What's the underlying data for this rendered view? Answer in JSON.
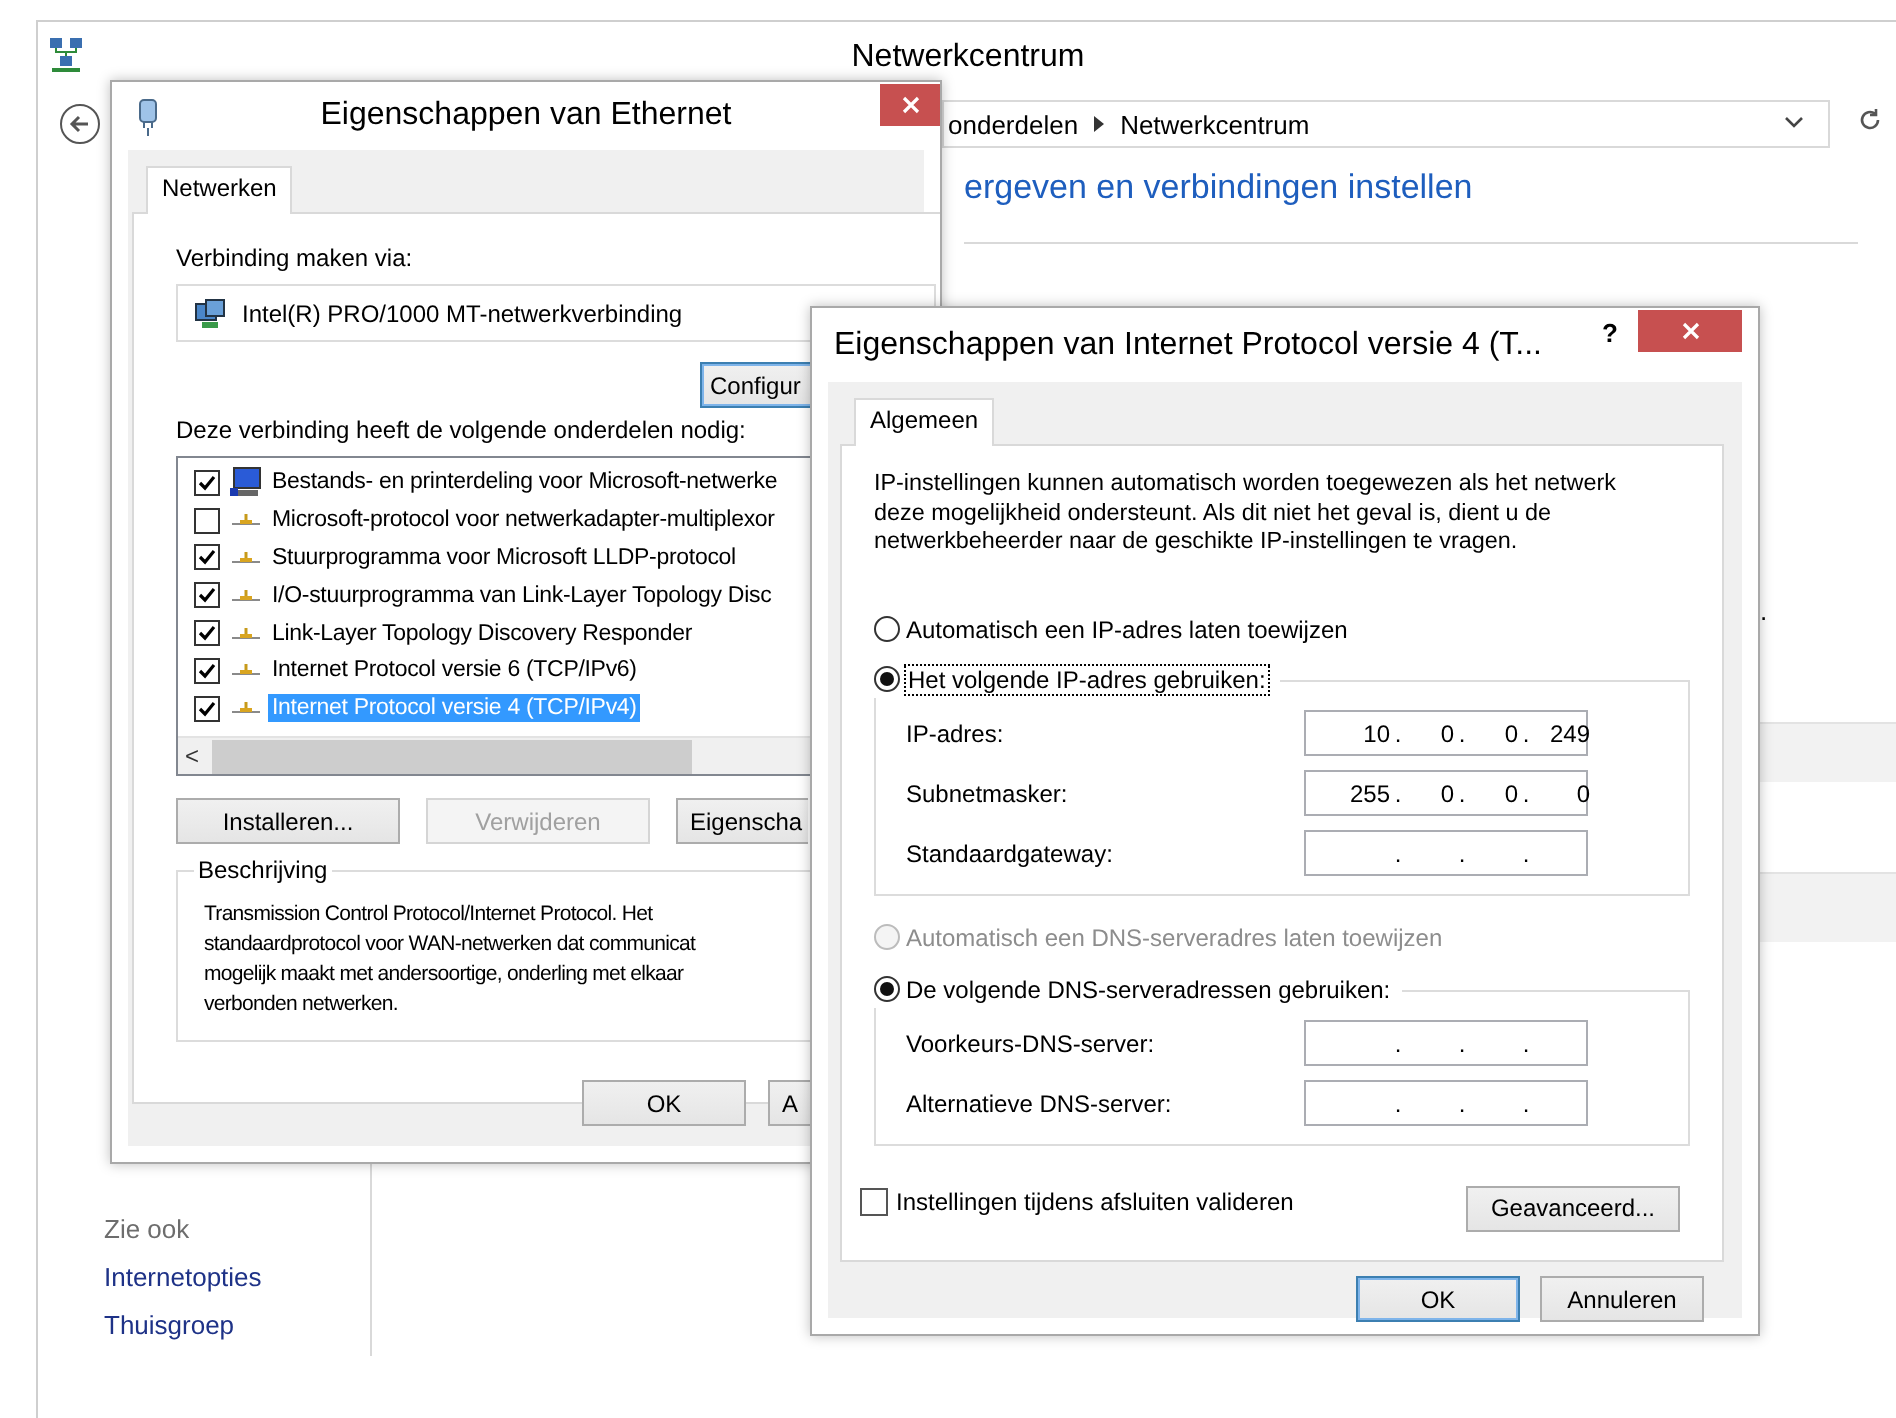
{
  "background_window": {
    "title": "Netwerkcentrum",
    "breadcrumb": [
      {
        "label": "onderdelen"
      },
      {
        "label": "Netwerkcentrum"
      }
    ],
    "heading": "ergeven en verbindingen instellen",
    "fragment": ".",
    "see_also": {
      "title": "Zie ook",
      "links": [
        "Internetopties",
        "Thuisgroep"
      ]
    }
  },
  "ethernet_dialog": {
    "title": "Eigenschappen van Ethernet",
    "tabs": [
      {
        "label": "Netwerken",
        "selected": true
      }
    ],
    "connect_via_label": "Verbinding maken via:",
    "adapter": "Intel(R) PRO/1000 MT-netwerkverbinding",
    "configure_button": {
      "label": "Configur",
      "default": true
    },
    "components_label": "Deze verbinding heeft de volgende onderdelen nodig:",
    "components": [
      {
        "kind": "computer",
        "label": "Bestands- en printerdeling voor Microsoft-netwerke",
        "checked": true,
        "selected": false
      },
      {
        "kind": "protocol",
        "label": "Microsoft-protocol voor netwerkadapter-multiplexor",
        "checked": false,
        "selected": false
      },
      {
        "kind": "protocol",
        "label": "Stuurprogramma voor Microsoft LLDP-protocol",
        "checked": true,
        "selected": false
      },
      {
        "kind": "protocol",
        "label": "I/O-stuurprogramma van Link-Layer Topology Disc",
        "checked": true,
        "selected": false
      },
      {
        "kind": "protocol",
        "label": "Link-Layer Topology Discovery Responder",
        "checked": true,
        "selected": false
      },
      {
        "kind": "protocol",
        "label": "Internet Protocol versie 6 (TCP/IPv6)",
        "checked": true,
        "selected": false
      },
      {
        "kind": "protocol",
        "label": "Internet Protocol versie 4 (TCP/IPv4)",
        "checked": true,
        "selected": true
      }
    ],
    "scroll_left": "<",
    "buttons": [
      {
        "label": "Installeren...",
        "disabled": false
      },
      {
        "label": "Verwijderen",
        "disabled": true
      },
      {
        "label": "Eigenscha",
        "disabled": false
      }
    ],
    "description": {
      "title": "Beschrijving",
      "lines": [
        "Transmission Control Protocol/Internet Protocol. Het",
        "standaardprotocol voor WAN-netwerken dat communicat",
        "mogelijk maakt met andersoortige, onderling met elkaar",
        "verbonden netwerken."
      ]
    },
    "footer_buttons": [
      {
        "label": "OK"
      },
      {
        "label": "A"
      }
    ]
  },
  "ipv4_dialog": {
    "title": "Eigenschappen van Internet Protocol versie 4 (T...",
    "help": "?",
    "tabs": [
      {
        "label": "Algemeen",
        "selected": true
      }
    ],
    "intro": "IP-instellingen kunnen automatisch worden toegewezen als het netwerk deze mogelijkheid ondersteunt. Als dit niet het geval is, dient u de netwerkbeheerder naar de geschikte IP-instellingen te vragen.",
    "ip_options": [
      {
        "label": "Automatisch een IP-adres laten toewijzen",
        "selected": false,
        "disabled": false,
        "focused": false
      },
      {
        "label": "Het volgende IP-adres gebruiken:",
        "selected": true,
        "disabled": false,
        "focused": true
      }
    ],
    "ip_fields": [
      {
        "label": "IP-adres:",
        "octets": [
          "10",
          "0",
          "0",
          "249"
        ],
        "dots": [
          ".",
          ".",
          "."
        ]
      },
      {
        "label": "Subnetmasker:",
        "octets": [
          "255",
          "0",
          "0",
          "0"
        ],
        "dots": [
          ".",
          ".",
          "."
        ]
      },
      {
        "label": "Standaardgateway:",
        "dots": [
          ".",
          ".",
          "."
        ]
      }
    ],
    "dns_options": [
      {
        "label": "Automatisch een DNS-serveradres laten toewijzen",
        "selected": false,
        "disabled": true,
        "focused": false
      },
      {
        "label": "De volgende DNS-serveradressen gebruiken:",
        "selected": true,
        "disabled": false,
        "focused": false
      }
    ],
    "dns_fields": [
      {
        "label": "Voorkeurs-DNS-server:",
        "dots": [
          ".",
          ".",
          "."
        ]
      },
      {
        "label": "Alternatieve DNS-server:",
        "dots": [
          ".",
          ".",
          "."
        ]
      }
    ],
    "validate": {
      "label": "Instellingen tijdens afsluiten valideren",
      "checked": false
    },
    "advanced_button": {
      "label": "Geavanceerd...",
      "default": false
    },
    "footer_buttons": [
      {
        "label": "OK",
        "default": true
      },
      {
        "label": "Annuleren",
        "default": false
      }
    ]
  }
}
